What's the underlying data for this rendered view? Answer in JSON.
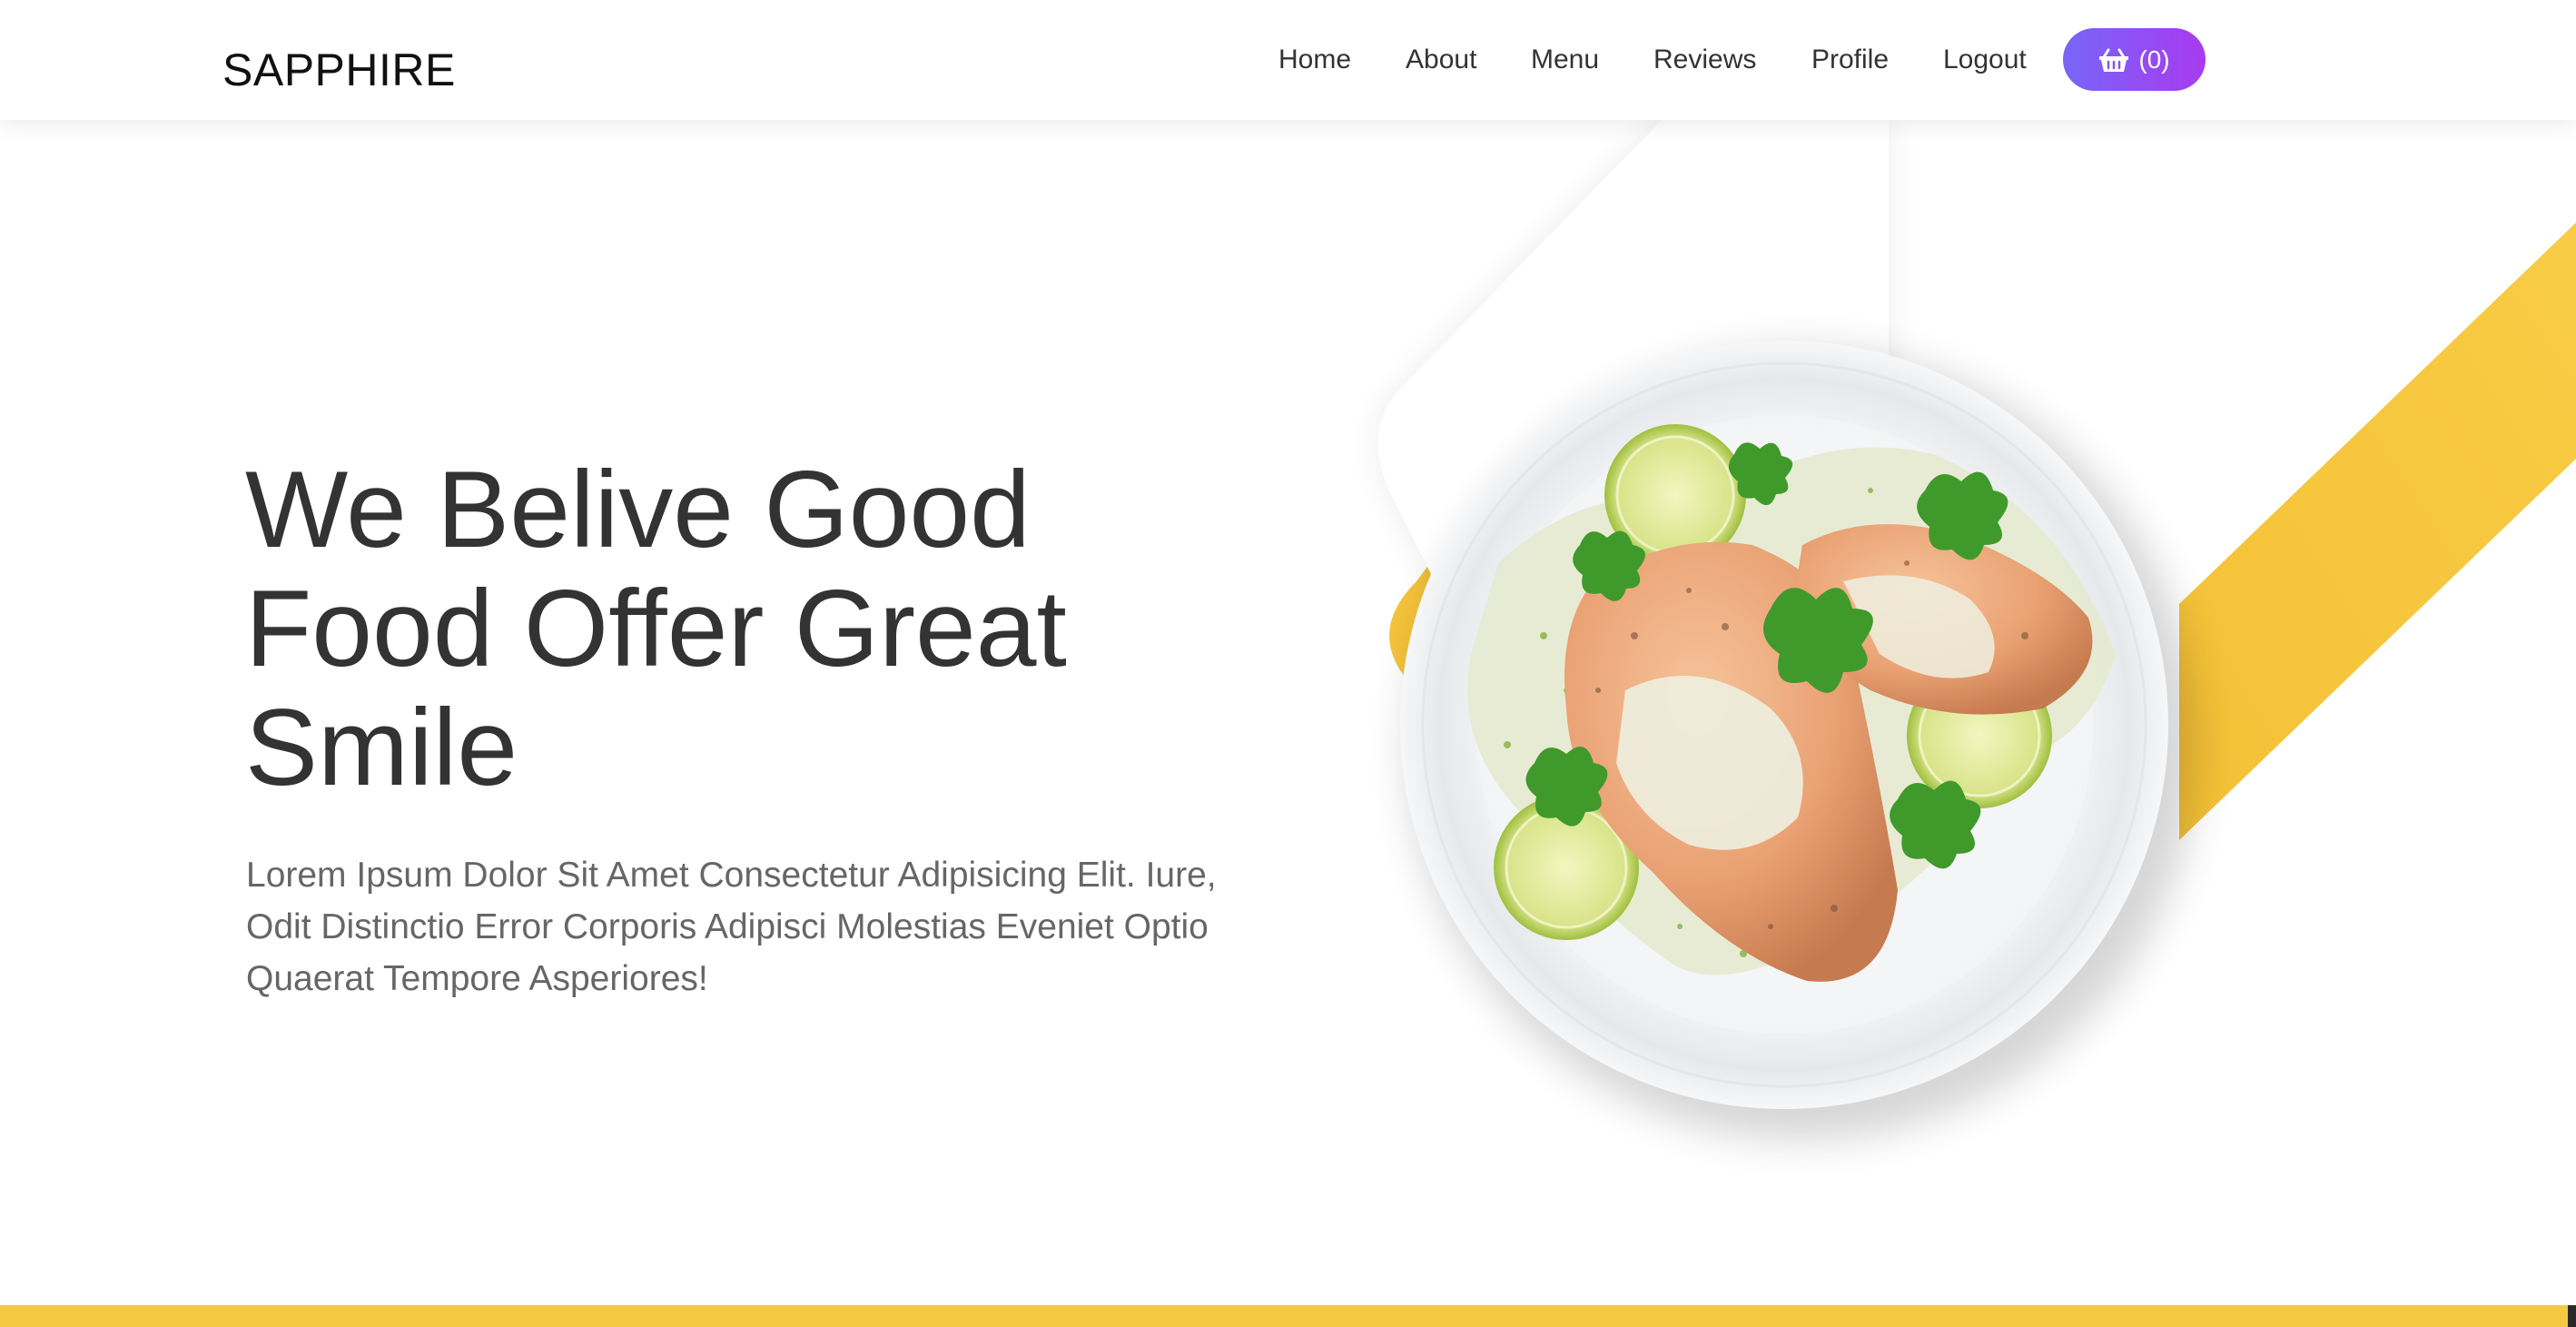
{
  "brand": {
    "name": "SAPPHIRE"
  },
  "nav": {
    "items": [
      {
        "label": "Home"
      },
      {
        "label": "About"
      },
      {
        "label": "Menu"
      },
      {
        "label": "Reviews"
      },
      {
        "label": "Profile"
      },
      {
        "label": "Logout"
      }
    ],
    "cart": {
      "icon": "basket-icon",
      "count_label": "(0)"
    }
  },
  "hero": {
    "title_lines": [
      "We Belive Good",
      "Food Offer Great",
      "Smile"
    ],
    "paragraph_lines": [
      "Lorem Ipsum Dolor Sit Amet Consectetur Adipisicing Elit. Iure,",
      "Odit Distinctio Error Corporis Adipisci Molestias Eveniet Optio",
      "Quaerat Tempore Asperiores!"
    ],
    "image": {
      "subject": "plate of grilled chicken breast with herb cream sauce, lime slices and cilantro"
    }
  },
  "colors": {
    "accent_yellow": "#f6c945",
    "cart_gradient_start": "#7766f7",
    "cart_gradient_end": "#a83af0",
    "text_dark": "#333333",
    "text_muted": "#666666"
  }
}
